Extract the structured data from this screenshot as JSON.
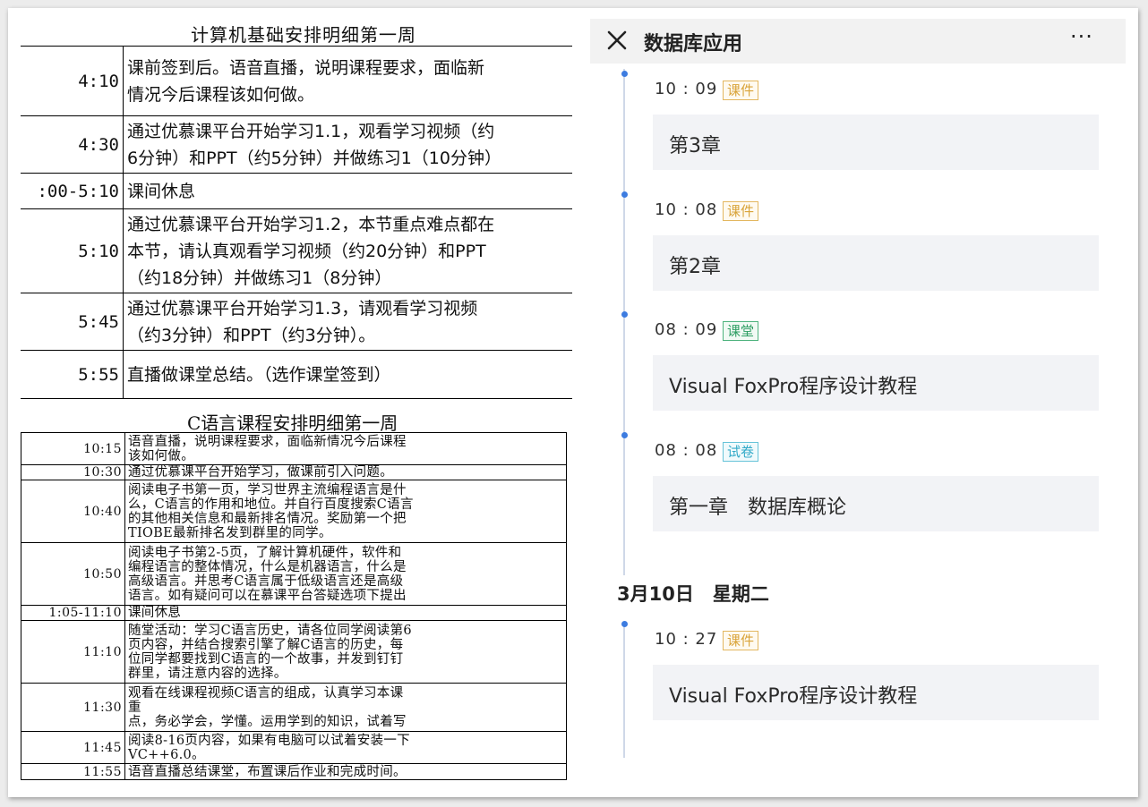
{
  "table1": {
    "title": "计算机基础安排明细第一周",
    "rows": [
      {
        "time": "4:10",
        "lines": [
          "课前签到后。语音直播，说明课程要求，面临新",
          "情况今后课程该如何做。"
        ]
      },
      {
        "time": "4:30",
        "lines": [
          "通过优慕课平台开始学习1.1，观看学习视频（约",
          "6分钟）和PPT（约5分钟）并做练习1（10分钟）"
        ]
      },
      {
        "time": ":00-5:10",
        "lines": [
          "课间休息"
        ]
      },
      {
        "time": "5:10",
        "lines": [
          "通过优慕课平台开始学习1.2，本节重点难点都在",
          "本节，请认真观看学习视频（约20分钟）和PPT",
          "（约18分钟）并做练习1（8分钟）"
        ]
      },
      {
        "time": "5:45",
        "lines": [
          "通过优慕课平台开始学习1.3，请观看学习视频",
          "（约3分钟）和PPT（约3分钟）。"
        ]
      },
      {
        "time": "5:55",
        "lines": [
          "直播做课堂总结。（选作课堂签到）"
        ]
      }
    ]
  },
  "table2": {
    "title": "C语言课程安排明细第一周",
    "rows": [
      {
        "time": "10:15",
        "lines": [
          "语音直播，说明课程要求，面临新情况今后课程",
          "该如何做。"
        ]
      },
      {
        "time": "10:30",
        "lines": [
          "通过优慕课平台开始学习，做课前引入问题。"
        ]
      },
      {
        "time": "10:40",
        "lines": [
          "阅读电子书第一页，学习世界主流编程语言是什",
          "么，C语言的作用和地位。并自行百度搜索C语言",
          "的其他相关信息和最新排名情况。奖励第一个把",
          "TIOBE最新排名发到群里的同学。"
        ]
      },
      {
        "time": "10:50",
        "lines": [
          "阅读电子书第2-5页，了解计算机硬件，软件和",
          "编程语言的整体情况，什么是机器语言，什么是",
          "高级语言。并思考C语言属于低级语言还是高级",
          "语言。如有疑问可以在慕课平台答疑选项下提出"
        ]
      },
      {
        "time": "1:05-11:10",
        "lines": [
          "课间休息"
        ]
      },
      {
        "time": "11:10",
        "lines": [
          "随堂活动：学习C语言历史，请各位同学阅读第6",
          "页内容，并结合搜索引擎了解C语言的历史，每",
          "位同学都要找到C语言的一个故事，并发到钉钉",
          "群里，请注意内容的选择。"
        ]
      },
      {
        "time": "11:30",
        "lines": [
          "观看在线课程视频C语言的组成，认真学习本课",
          "重",
          "点，务必学会，学懂。运用学到的知识，试着写"
        ]
      },
      {
        "time": "11:45",
        "lines": [
          "阅读8-16页内容，如果有电脑可以试着安装一下",
          "VC++6.0。"
        ]
      },
      {
        "time": "11:55",
        "lines": [
          "语音直播总结课堂，布置课后作业和完成时间。"
        ]
      }
    ]
  },
  "app": {
    "title": "数据库应用",
    "close_icon": "close-icon",
    "more_icon": "more-icon",
    "more_glyph": "···",
    "entries": [
      {
        "time": "10 : 09",
        "tag": "课件",
        "tag_type": "courseware",
        "card": "第3章"
      },
      {
        "time": "10 : 08",
        "tag": "课件",
        "tag_type": "courseware",
        "card": "第2章"
      },
      {
        "time": "08 : 09",
        "tag": "课堂",
        "tag_type": "class",
        "card": "Visual FoxPro程序设计教程"
      },
      {
        "time": "08 : 08",
        "tag": "试卷",
        "tag_type": "exam",
        "card": "第一章　数据库概论"
      }
    ],
    "date_header": "3月10日　星期二",
    "entries2": [
      {
        "time": "10 : 27",
        "tag": "课件",
        "tag_type": "courseware",
        "card": "Visual FoxPro程序设计教程"
      }
    ],
    "colors": {
      "courseware": "#d9a43a",
      "class": "#2e9e63",
      "exam": "#33aac8",
      "timeline_dot": "#3d7ce0",
      "card_bg": "#f2f3f6",
      "topbar_bg": "#f2f2f2"
    }
  }
}
